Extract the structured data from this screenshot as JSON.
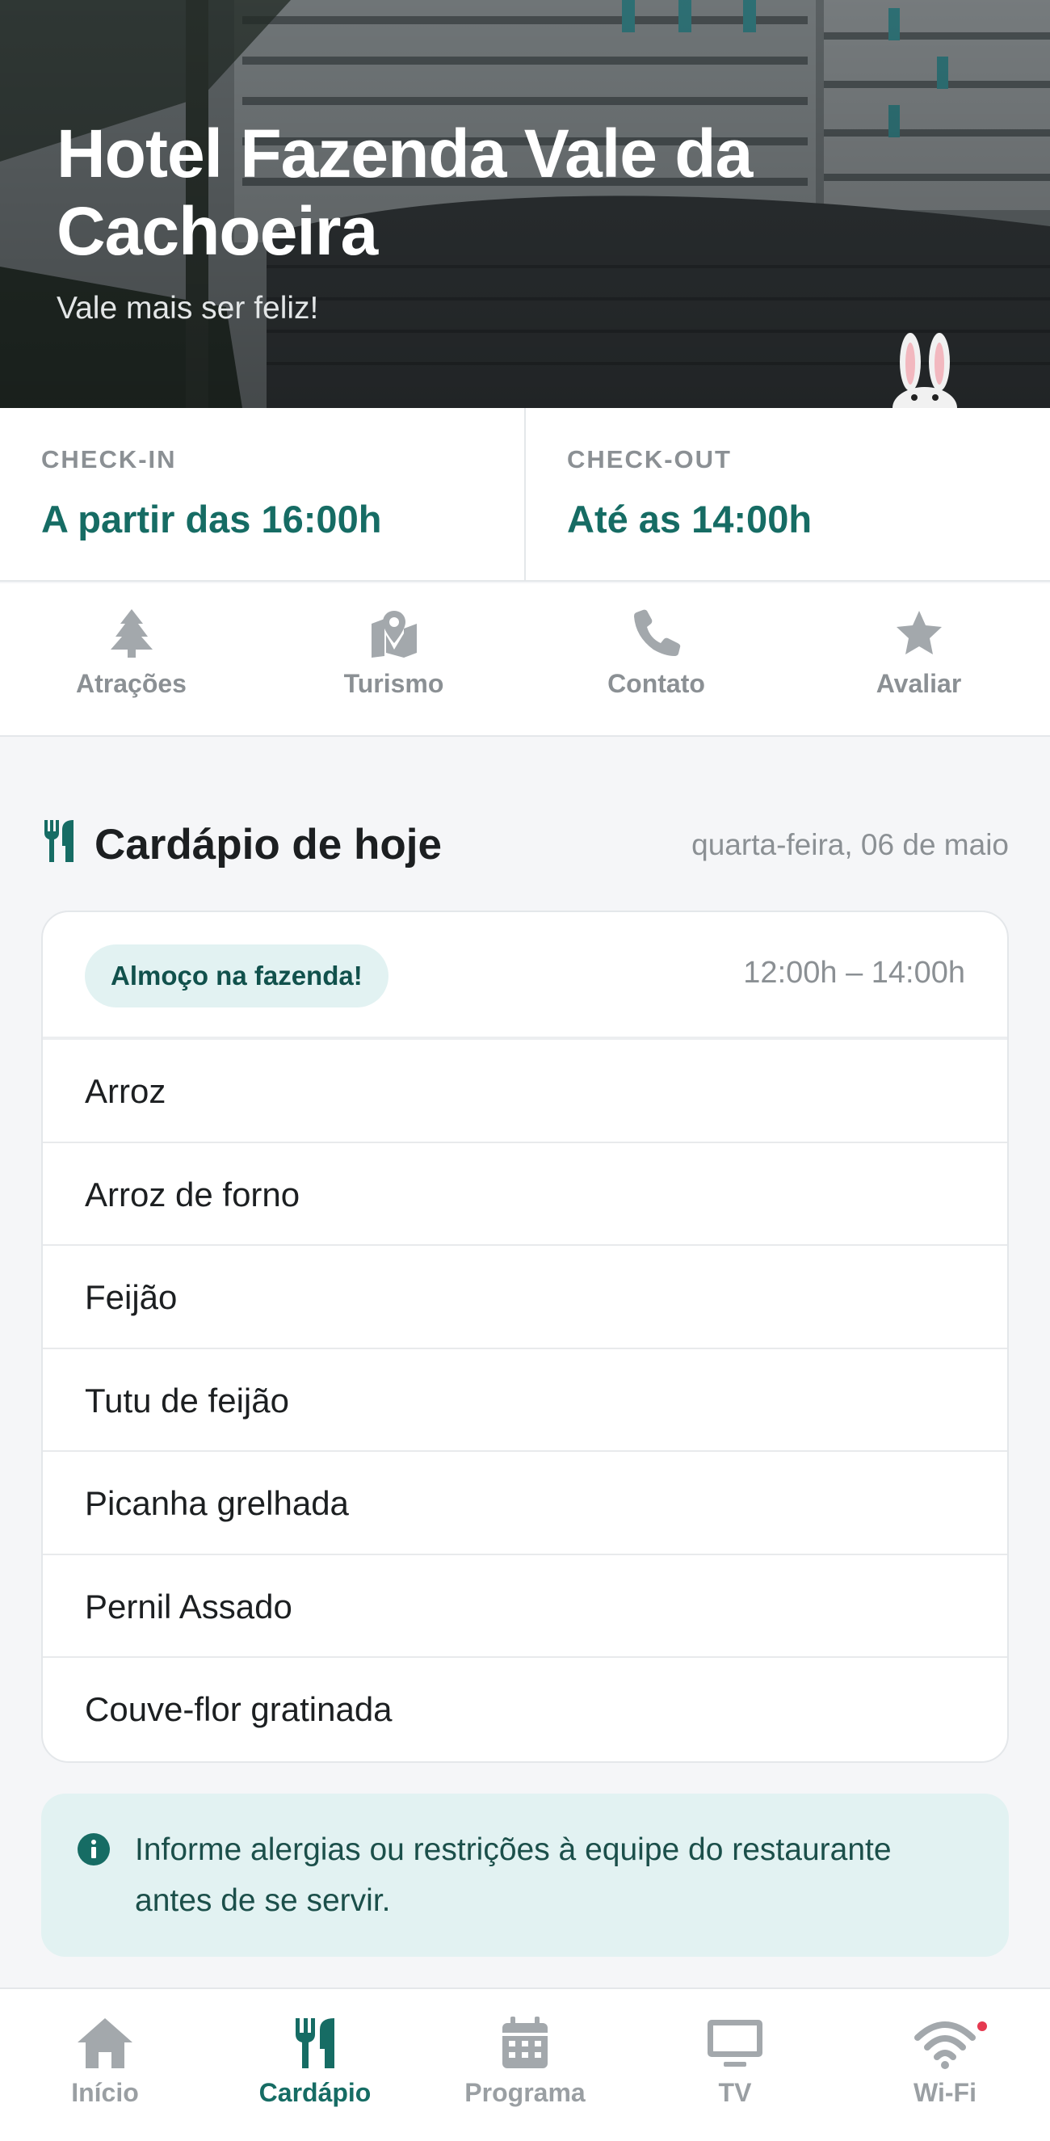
{
  "hero": {
    "title": "Hotel Fazenda Vale da Cachoeira",
    "subtitle": "Vale mais ser feliz!"
  },
  "checkin": {
    "label": "CHECK-IN",
    "value": "A partir das 16:00h"
  },
  "checkout": {
    "label": "CHECK-OUT",
    "value": "Até as 14:00h"
  },
  "quick_actions": [
    {
      "label": "Atrações",
      "icon": "tree-icon"
    },
    {
      "label": "Turismo",
      "icon": "map-pin-icon"
    },
    {
      "label": "Contato",
      "icon": "phone-icon"
    },
    {
      "label": "Avaliar",
      "icon": "star-icon"
    }
  ],
  "menu_section": {
    "title": "Cardápio de hoje",
    "date": "quarta-feira, 06 de maio"
  },
  "meal": {
    "name": "Almoço na fazenda!",
    "time": "12:00h – 14:00h",
    "items": [
      "Arroz",
      "Arroz de forno",
      "Feijão",
      "Tutu de feijão",
      "Picanha grelhada",
      "Pernil Assado",
      "Couve-flor gratinada"
    ]
  },
  "notice": {
    "text": "Informe alergias ou restrições à equipe do restaurante antes de se servir."
  },
  "bottom_nav": [
    {
      "label": "Início",
      "icon": "home-icon"
    },
    {
      "label": "Cardápio",
      "icon": "utensils-icon",
      "active": true
    },
    {
      "label": "Programa",
      "icon": "calendar-icon"
    },
    {
      "label": "TV",
      "icon": "tv-icon"
    },
    {
      "label": "Wi-Fi",
      "icon": "wifi-icon"
    }
  ],
  "colors": {
    "accent": "#166c64",
    "muted": "#8b9094",
    "pill_bg": "#e2f2f2",
    "notification_dot": "#e53950"
  }
}
